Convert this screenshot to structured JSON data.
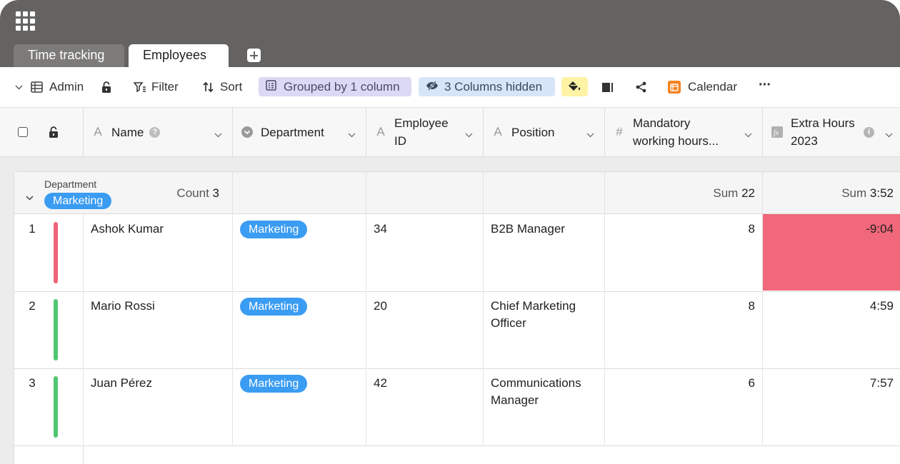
{
  "tabs": [
    {
      "label": "Time tracking",
      "active": false
    },
    {
      "label": "Employees",
      "active": true
    }
  ],
  "toolbar": {
    "view_name": "Admin",
    "filter_label": "Filter",
    "sort_label": "Sort",
    "group_label": "Grouped by 1 column",
    "hidden_label": "3 Columns hidden",
    "calendar_label": "Calendar",
    "more_label": "···"
  },
  "columns": [
    {
      "label": "Name",
      "icon": "text-icon"
    },
    {
      "label": "Department",
      "icon": "single-select-icon"
    },
    {
      "label": "Employee ID",
      "icon": "text-icon"
    },
    {
      "label": "Position",
      "icon": "text-icon"
    },
    {
      "label": "Mandatory working hours...",
      "icon": "number-icon"
    },
    {
      "label": "Extra Hours 2023",
      "icon": "formula-icon"
    }
  ],
  "group": {
    "field": "Department",
    "value": "Marketing",
    "count_label": "Count",
    "count": "3",
    "sum_label": "Sum",
    "sum_hours": "22",
    "sum_extra": "3:52"
  },
  "rows": [
    {
      "num": "1",
      "name": "Ashok Kumar",
      "department": "Marketing",
      "employee_id": "34",
      "position": "B2B Manager",
      "hours": "8",
      "extra": "-9:04",
      "bar_color": "#ee6478"
    },
    {
      "num": "2",
      "name": "Mario Rossi",
      "department": "Marketing",
      "employee_id": "20",
      "position": "Chief Marketing Officer",
      "hours": "8",
      "extra": "4:59",
      "bar_color": "#4fc770"
    },
    {
      "num": "3",
      "name": "Juan Pérez",
      "department": "Marketing",
      "employee_id": "42",
      "position": "Communications Manager",
      "hours": "6",
      "extra": "7:57",
      "bar_color": "#4fc770"
    }
  ],
  "colors": {
    "accent_pill": "#3a9cf2",
    "negative": "#f0687a",
    "topbar": "#646362"
  }
}
